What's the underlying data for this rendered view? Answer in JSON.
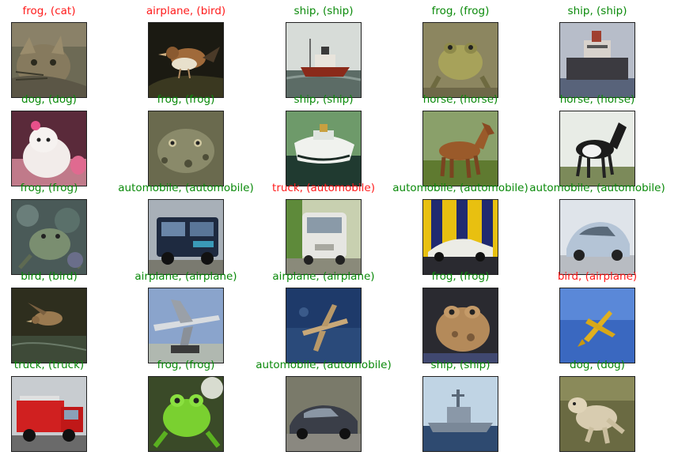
{
  "colors": {
    "correct": "#008000",
    "wrong": "#ff0000"
  },
  "grid": {
    "rows": 5,
    "cols": 5,
    "cells": [
      {
        "label": "frog, (cat)",
        "correct": false,
        "subject": "cat-image"
      },
      {
        "label": "airplane, (bird)",
        "correct": false,
        "subject": "bird-image"
      },
      {
        "label": "ship, (ship)",
        "correct": true,
        "subject": "ship-image"
      },
      {
        "label": "frog, (frog)",
        "correct": true,
        "subject": "frog-image"
      },
      {
        "label": "ship, (ship)",
        "correct": true,
        "subject": "ship-image"
      },
      {
        "label": "dog, (dog)",
        "correct": true,
        "subject": "dog-image"
      },
      {
        "label": "frog, (frog)",
        "correct": true,
        "subject": "frog-image"
      },
      {
        "label": "ship, (ship)",
        "correct": true,
        "subject": "ship-image"
      },
      {
        "label": "horse, (horse)",
        "correct": true,
        "subject": "horse-image"
      },
      {
        "label": "horse, (horse)",
        "correct": true,
        "subject": "horse-image"
      },
      {
        "label": "frog, (frog)",
        "correct": true,
        "subject": "frog-image"
      },
      {
        "label": "automobile, (automobile)",
        "correct": true,
        "subject": "truck-image"
      },
      {
        "label": "truck, (automobile)",
        "correct": false,
        "subject": "van-image"
      },
      {
        "label": "automobile, (automobile)",
        "correct": true,
        "subject": "car-image"
      },
      {
        "label": "automobile, (automobile)",
        "correct": true,
        "subject": "car-image"
      },
      {
        "label": "bird, (bird)",
        "correct": true,
        "subject": "bird-image"
      },
      {
        "label": "airplane, (airplane)",
        "correct": true,
        "subject": "airplane-image"
      },
      {
        "label": "airplane, (airplane)",
        "correct": true,
        "subject": "airplane-image"
      },
      {
        "label": "frog, (frog)",
        "correct": true,
        "subject": "frog-image"
      },
      {
        "label": "bird, (airplane)",
        "correct": false,
        "subject": "airplane-image"
      },
      {
        "label": "truck, (truck)",
        "correct": true,
        "subject": "firetruck-image"
      },
      {
        "label": "frog, (frog)",
        "correct": true,
        "subject": "frog-image"
      },
      {
        "label": "automobile, (automobile)",
        "correct": true,
        "subject": "car-image"
      },
      {
        "label": "ship, (ship)",
        "correct": true,
        "subject": "ship-image"
      },
      {
        "label": "dog, (dog)",
        "correct": true,
        "subject": "dog-image"
      }
    ]
  }
}
